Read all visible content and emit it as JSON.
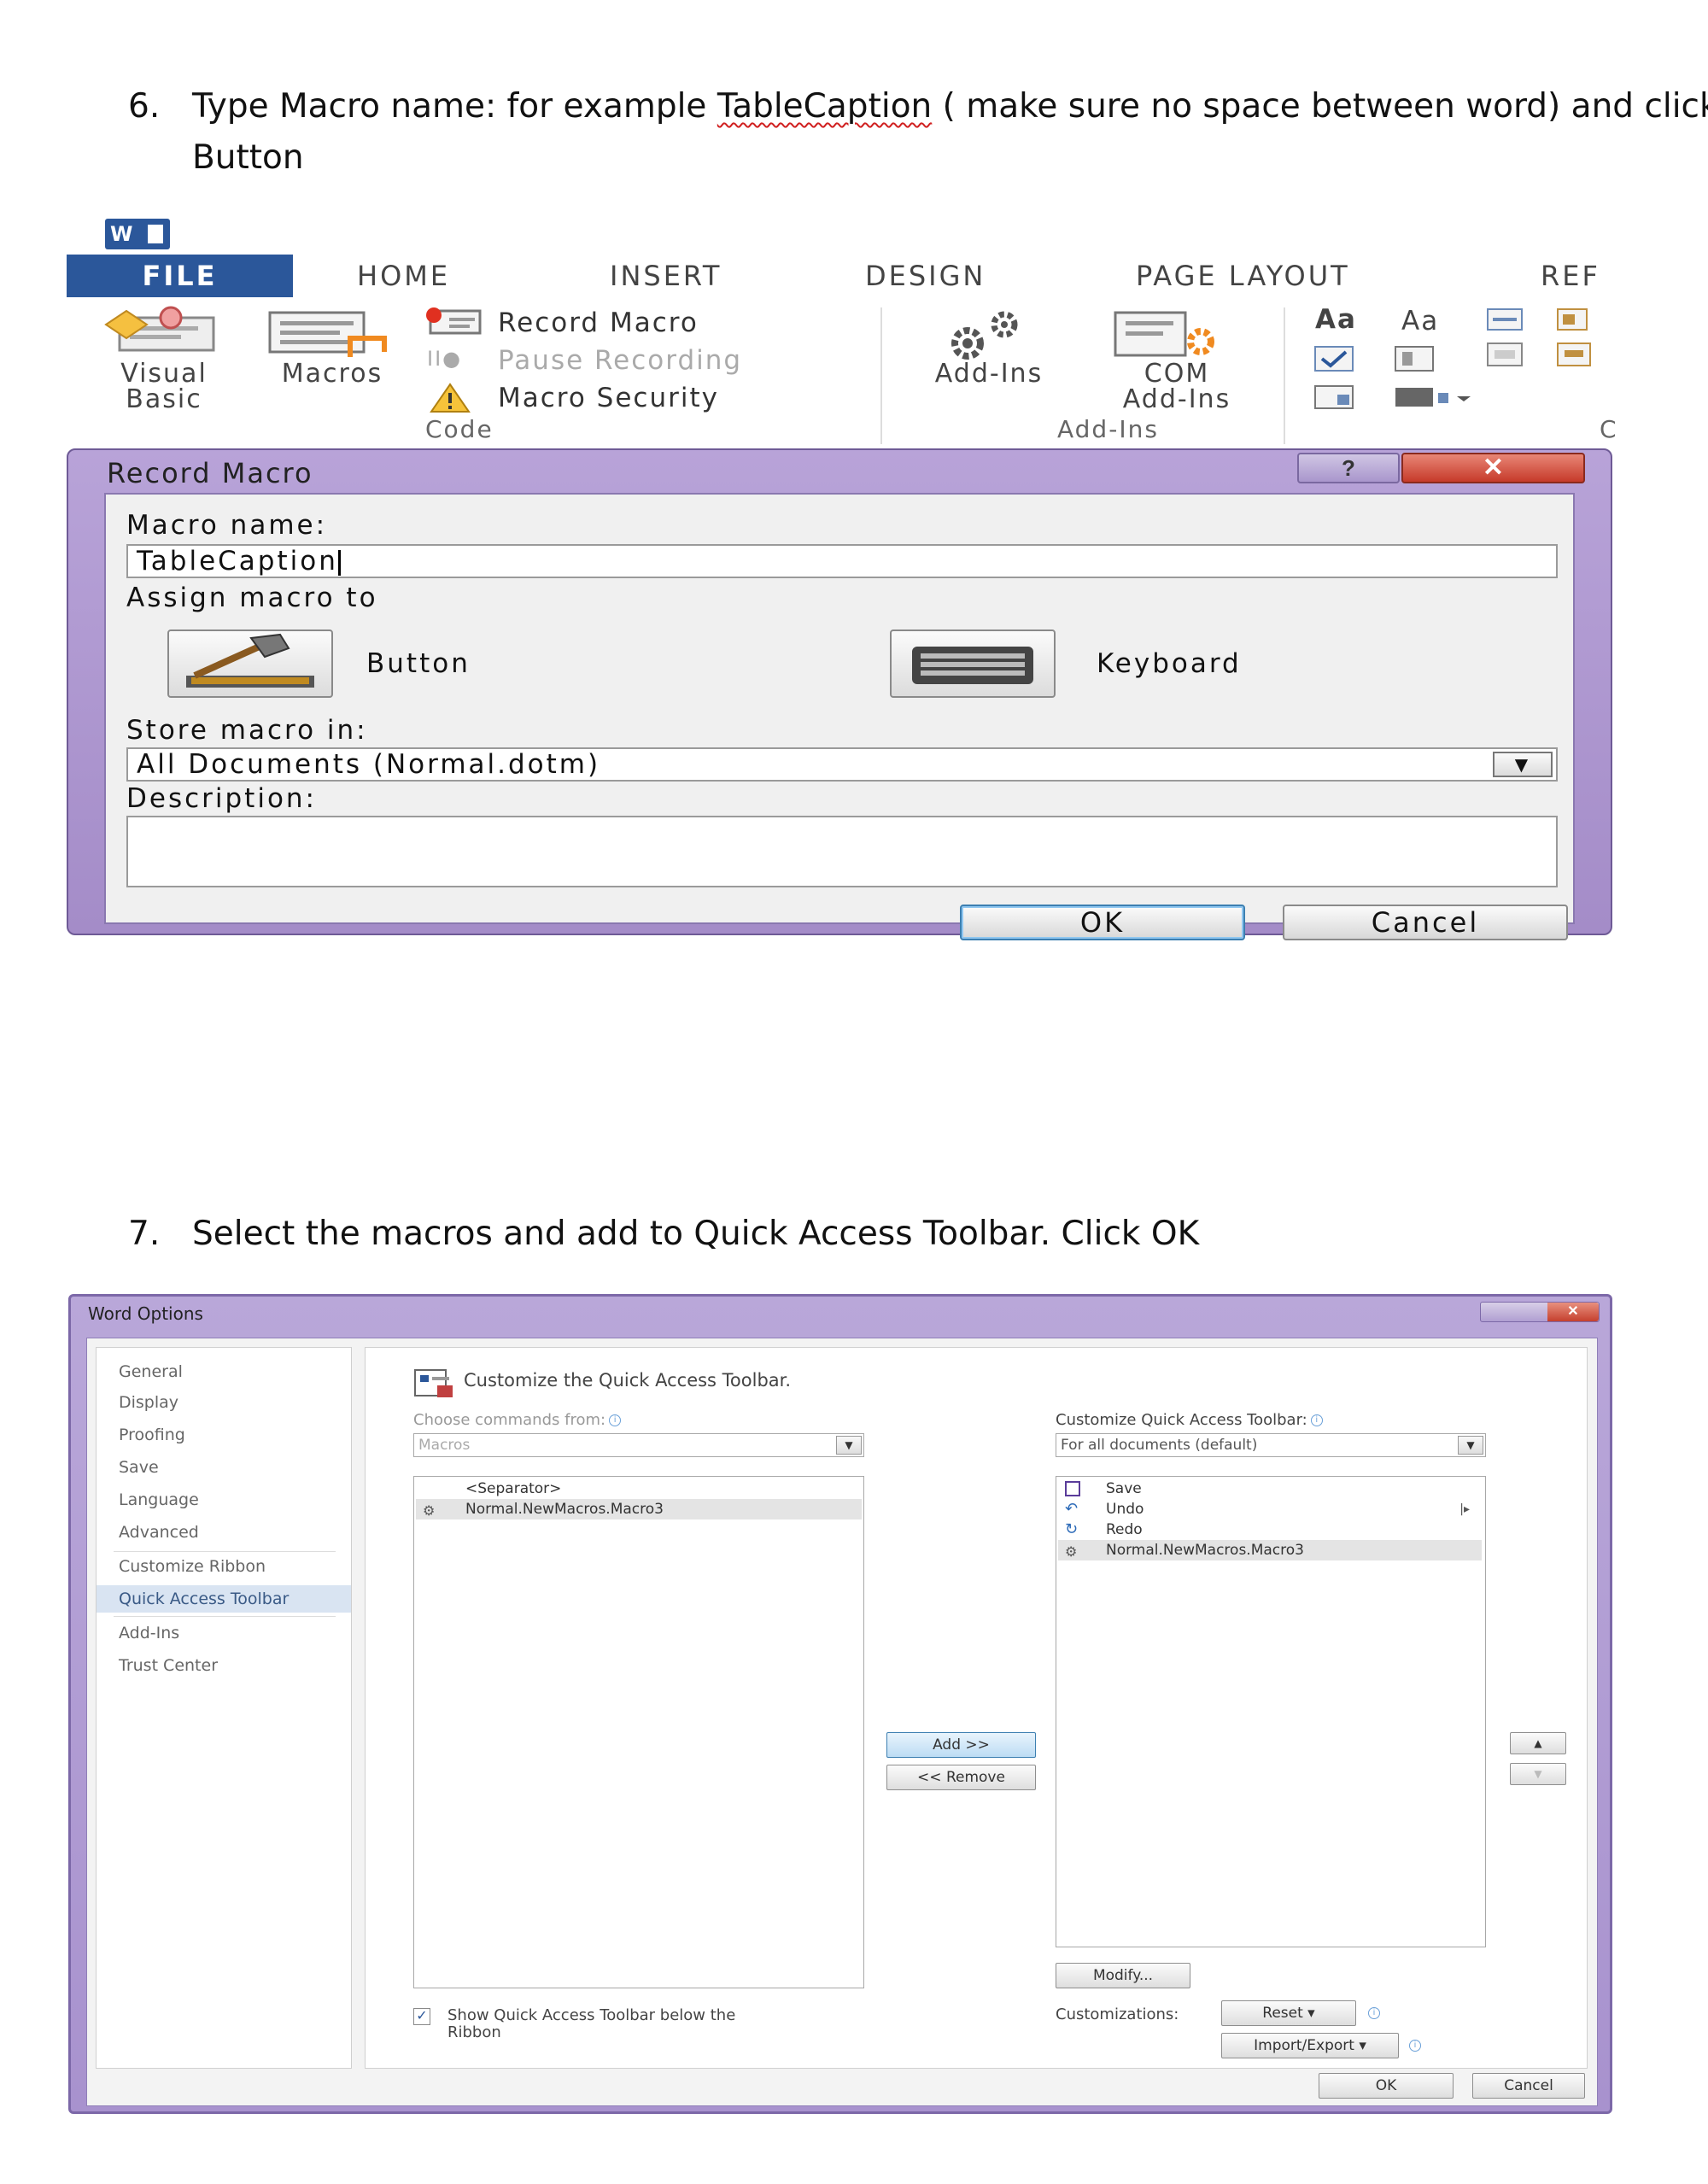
{
  "steps": {
    "step6_num": "6.",
    "step6_pre": "Type Macro name: for example ",
    "step6_example": "TableCaption",
    "step6_post": " ( make sure no space between word) and click",
    "step6_line2": "Button",
    "step7_num": "7.",
    "step7_text": "Select the macros and add to Quick Access Toolbar. Click OK"
  },
  "ribbon": {
    "app_badge": "W",
    "tabs": [
      "FILE",
      "HOME",
      "INSERT",
      "DESIGN",
      "PAGE LAYOUT",
      "REF"
    ],
    "code_group": {
      "visual_basic_line1": "Visual",
      "visual_basic_line2": "Basic",
      "macros": "Macros",
      "record_macro": "Record Macro",
      "pause_recording": "Pause Recording",
      "macro_security": "Macro Security",
      "label": "Code"
    },
    "addins_group": {
      "addins": "Add-Ins",
      "com_line1": "COM",
      "com_line2": "Add-Ins",
      "label": "Add-Ins"
    },
    "controls_group": {
      "aa1": "Aa",
      "aa2": "Aa",
      "label_fragment": "C"
    }
  },
  "record_macro_dialog": {
    "title": "Record Macro",
    "help": "?",
    "close": "✕",
    "macro_name_label": "Macro name:",
    "macro_name_value": "TableCaption",
    "assign_label": "Assign macro to",
    "button_label": "Button",
    "keyboard_label": "Keyboard",
    "store_label": "Store macro in:",
    "store_value": "All Documents (Normal.dotm)",
    "description_label": "Description:",
    "description_value": "",
    "ok": "OK",
    "cancel": "Cancel"
  },
  "word_options": {
    "title": "Word Options",
    "controls": "?",
    "close": "✕",
    "nav": [
      "General",
      "Display",
      "Proofing",
      "Save",
      "Language",
      "Advanced",
      "Customize Ribbon",
      "Quick Access Toolbar",
      "Add-Ins",
      "Trust Center"
    ],
    "nav_selected": "Quick Access Toolbar",
    "heading": "Customize the Quick Access Toolbar.",
    "choose_label": "Choose commands from:",
    "choose_value": "Macros",
    "left_list": [
      "<Separator>",
      "Normal.NewMacros.Macro3"
    ],
    "customize_label": "Customize Quick Access Toolbar:",
    "customize_value": "For all documents (default)",
    "right_list": [
      "Save",
      "Undo",
      "Redo",
      "Normal.NewMacros.Macro3"
    ],
    "add_button": "Add >>",
    "remove_button": "<< Remove",
    "modify_button": "Modify...",
    "customizations_label": "Customizations:",
    "reset_button": "Reset ▾",
    "import_export_button": "Import/Export ▾",
    "show_below_line1": "Show Quick Access Toolbar below the",
    "show_below_line2": "Ribbon",
    "show_below_checked": true,
    "ok": "OK",
    "cancel": "Cancel"
  },
  "colors": {
    "word_blue": "#2b579a",
    "dialog_purple": "#a48cc8",
    "close_red": "#c63a2a",
    "spell_red": "#d02020"
  }
}
